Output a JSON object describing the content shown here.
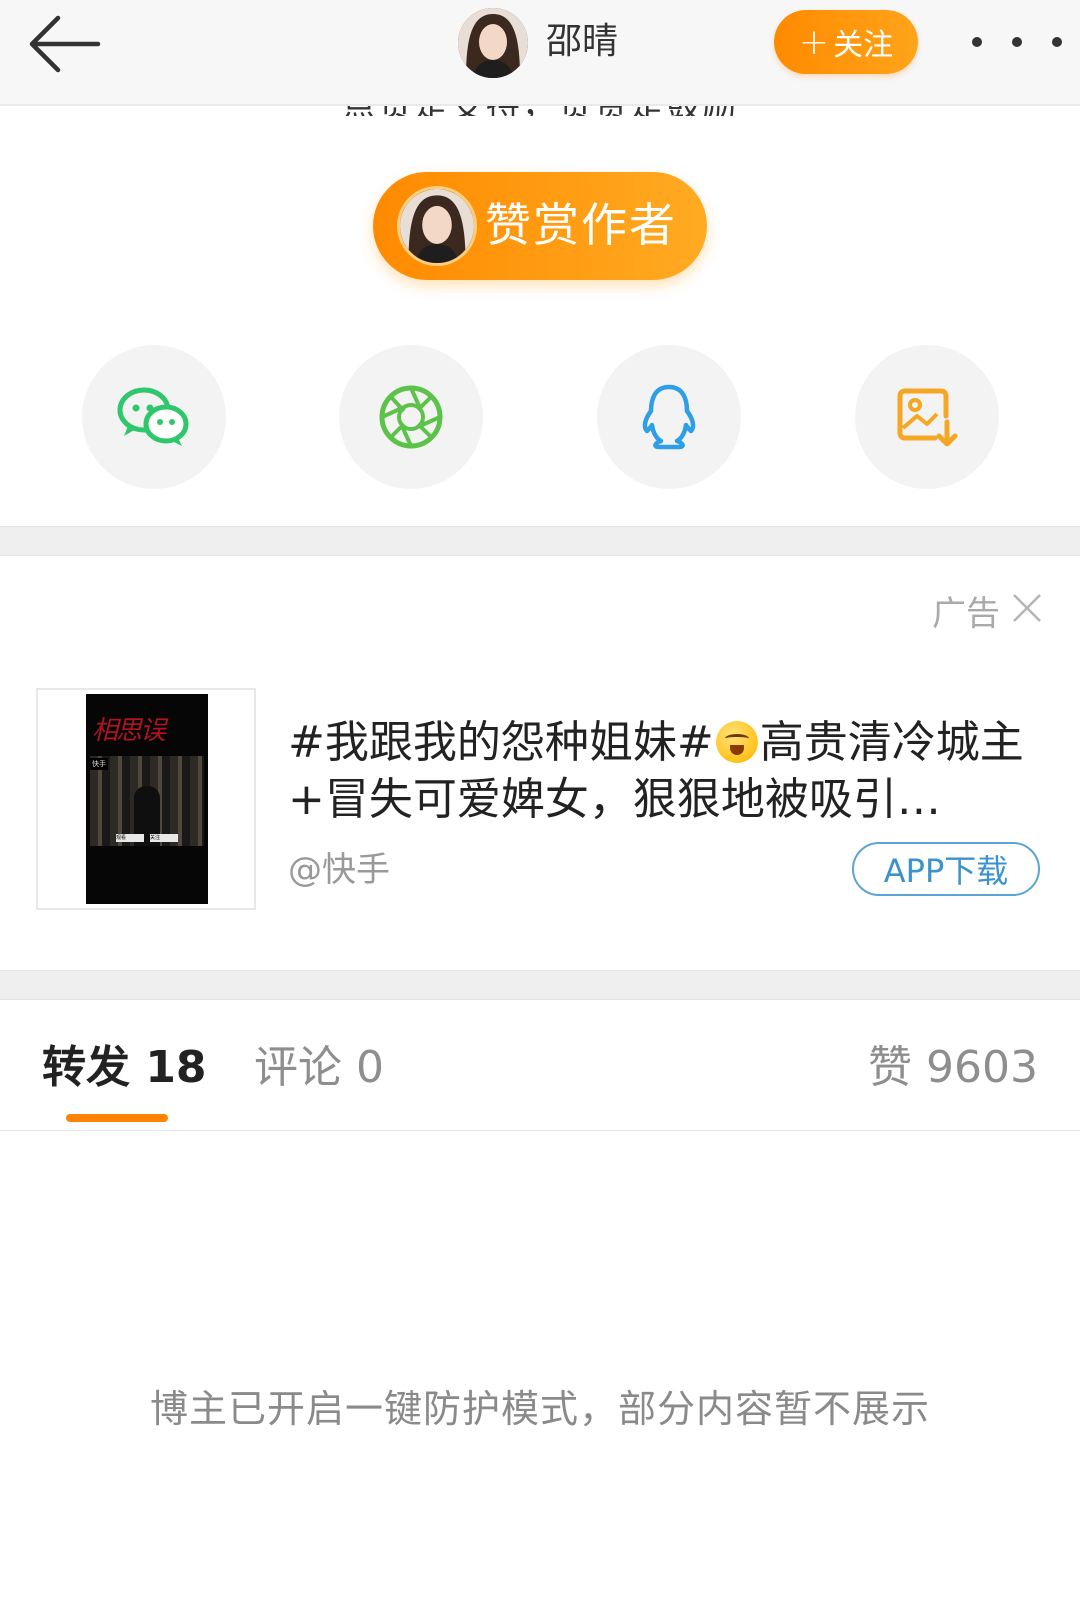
{
  "header": {
    "user_name": "邵晴",
    "follow_label": "关注",
    "follow_plus": "+"
  },
  "post": {
    "clipped_line": "点赞是支持，赞赏是鼓励"
  },
  "reward": {
    "label": "赞赏作者"
  },
  "share": {
    "items": [
      {
        "icon": "wechat-icon",
        "color": "#2fc76b"
      },
      {
        "icon": "moments-icon",
        "color": "#5cc24a"
      },
      {
        "icon": "qq-icon",
        "color": "#2e9ee6"
      },
      {
        "icon": "save-image-icon",
        "color": "#f5a623"
      }
    ]
  },
  "ad": {
    "label": "广告",
    "text": "#我跟我的怨种姐妹#",
    "text_rest": "高贵清冷城主+冒失可爱婢女，狠狠地被吸引…",
    "source": "@快手",
    "button": "APP下载",
    "poster_title": "相思误",
    "poster_tag": "快手",
    "poster_btn1": "观看",
    "poster_btn2": "关注"
  },
  "tabs": {
    "repost": "转发 18",
    "comment": "评论 0",
    "like": "赞 9603",
    "accent": "#ff8200"
  },
  "notice": "博主已开启一键防护模式，部分内容暂不展示"
}
